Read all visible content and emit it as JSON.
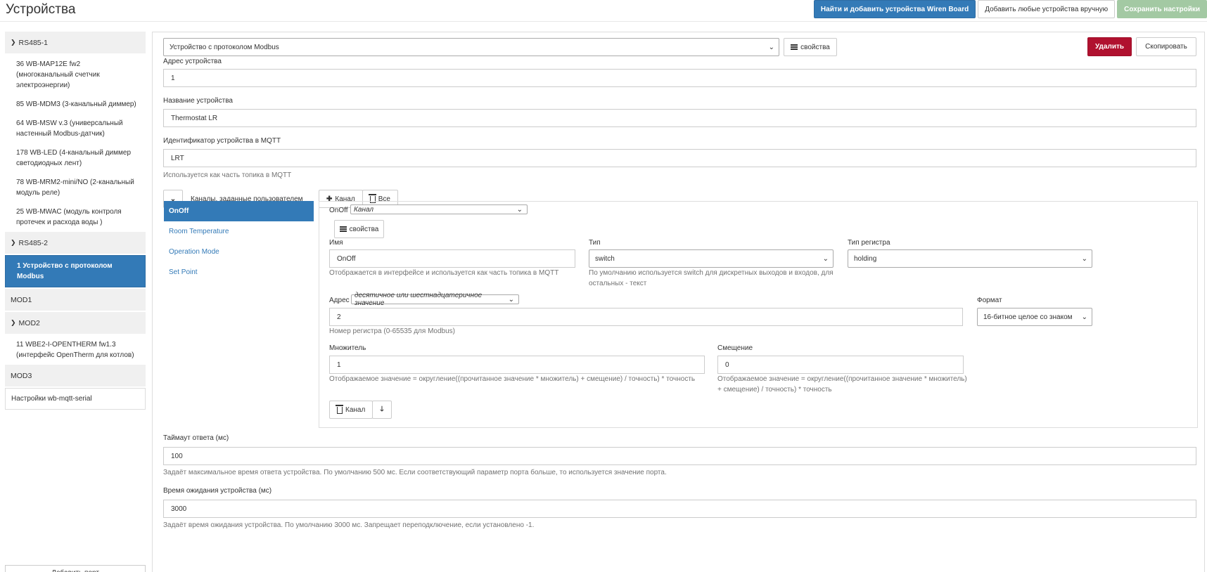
{
  "page": {
    "title": "Устройства"
  },
  "toolbar": {
    "find_add_label": "Найти и добавить устройства Wiren Board",
    "add_manual_label": "Добавить любые устройства вручную",
    "save_label": "Сохранить настройки"
  },
  "sidebar": {
    "groups": [
      {
        "name": "RS485-1",
        "expanded": true,
        "items": [
          "36 WB-MAP12E fw2 (многоканальный счетчик электроэнергии)",
          "85 WB-MDM3 (3-канальный диммер)",
          "64 WB-MSW v.3 (универсальный настенный Modbus-датчик)",
          "178 WB-LED (4-канальный диммер светодиодных лент)",
          "78 WB-MRM2-mini/NO (2-канальный модуль реле)",
          "25 WB-MWAC (модуль контроля протечек и расхода воды )"
        ]
      },
      {
        "name": "RS485-2",
        "expanded": true,
        "items": [
          "1 Устройство с протоколом Modbus"
        ]
      },
      {
        "name": "MOD1",
        "expanded": false,
        "items": []
      },
      {
        "name": "MOD2",
        "expanded": true,
        "items": [
          "11 WBE2-I-OPENTHERM fw1.3 (интерфейс OpenTherm для котлов)"
        ]
      },
      {
        "name": "MOD3",
        "expanded": false,
        "items": []
      }
    ],
    "settings_label": "Настройки wb-mqtt-serial",
    "add_port_label": "Добавить порт"
  },
  "device": {
    "type_select": "Устройство с протоколом Modbus",
    "properties_label": "свойства",
    "delete_label": "Удалить",
    "copy_label": "Скопировать",
    "address_label": "Адрес устройства",
    "address_value": "1",
    "name_label": "Название устройства",
    "name_value": "Thermostat LR",
    "mqtt_id_label": "Идентификатор устройства в MQTT",
    "mqtt_id_value": "LRT",
    "mqtt_id_help": "Используется как часть топика в MQTT",
    "channels_header": "Каналы, заданные пользователем",
    "add_channel_label": "Канал",
    "all_label": "Все",
    "channels": [
      "OnOff",
      "Room Temperature",
      "Operation Mode",
      "Set Point"
    ],
    "response_timeout_label": "Таймаут ответа (мс)",
    "response_timeout_value": "100",
    "response_timeout_help": "Задаёт максимальное время ответа устройства. По умолчанию 500 мс. Если соответствующий параметр порта больше, то используется значение порта.",
    "device_timeout_label": "Время ожидания устройства (мс)",
    "device_timeout_value": "3000",
    "device_timeout_help": "Задаёт время ожидания устройства. По умолчанию 3000 мс. Запрещает переподключение, если установлено -1."
  },
  "channel": {
    "title": "OnOff",
    "kind_select": "Канал",
    "properties_label": "свойства",
    "name_label": "Имя",
    "name_value": "OnOff",
    "name_help": "Отображается в интерфейсе и используется как часть топика в MQTT",
    "type_label": "Тип",
    "type_value": "switch",
    "type_help": "По умолчанию используется switch для дискретных выходов и входов, для остальных - текст",
    "reg_type_label": "Тип регистра",
    "reg_type_value": "holding",
    "address_label": "Адрес",
    "address_mode": "десятичное или шестнадцатеричное значение",
    "address_value": "2",
    "address_help": "Номер регистра (0-65535 для Modbus)",
    "format_label": "Формат",
    "format_value": "16-битное целое со знаком",
    "scale_label": "Множитель",
    "scale_value": "1",
    "scale_help": "Отображаемое значение = округление((прочитанное значение * множитель) + смещение) / точность) * точность",
    "offset_label": "Смещение",
    "offset_value": "0",
    "offset_help": "Отображаемое значение = округление((прочитанное значение * множитель) + смещение) / точность) * точность",
    "delete_label": "Канал"
  }
}
